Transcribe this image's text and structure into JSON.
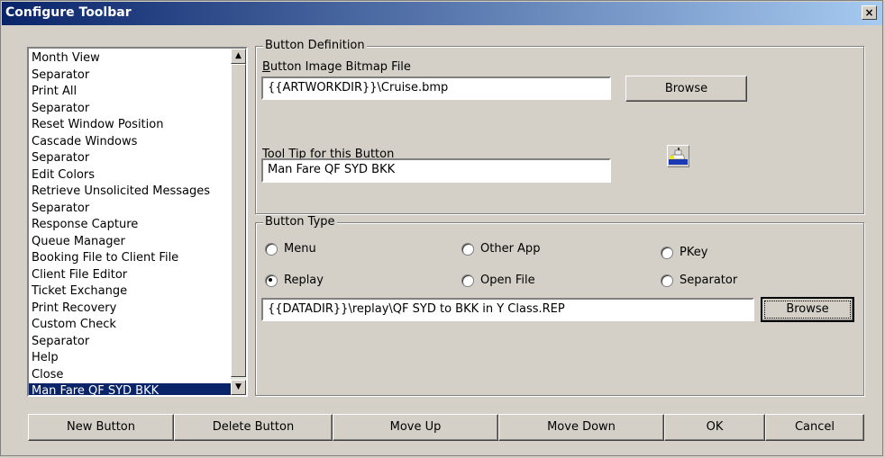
{
  "window": {
    "title": "Configure Toolbar",
    "close_glyph": "×"
  },
  "list": {
    "items": [
      "Month View",
      "Separator",
      "Print All",
      "Separator",
      "Reset Window Position",
      "Cascade Windows",
      "Separator",
      "Edit Colors",
      "Retrieve Unsolicited Messages",
      "Separator",
      "Response Capture",
      "Queue Manager",
      "Booking File to Client File",
      "Client File Editor",
      "Ticket Exchange",
      "Print Recovery",
      "Custom Check",
      "Separator",
      "Help",
      "Close",
      "Man Fare QF SYD BKK"
    ],
    "selected_index": 20,
    "scroll_up_glyph": "▲",
    "scroll_down_glyph": "▼"
  },
  "button_definition": {
    "legend": "Button Definition",
    "bitmap_label": "Button Image Bitmap File",
    "bitmap_value": "{{ARTWORKDIR}}\\Cruise.bmp",
    "browse_label": "Browse",
    "tooltip_label": "Tool Tip for this Button",
    "tooltip_value": "Man Fare QF SYD BKK",
    "preview_icon": "cruise-ship-icon"
  },
  "button_type": {
    "legend": "Button Type",
    "options": [
      {
        "label": "Menu",
        "checked": false
      },
      {
        "label": "Other App",
        "checked": false
      },
      {
        "label": "PKey",
        "checked": false
      },
      {
        "label": "Replay",
        "checked": true
      },
      {
        "label": "Open File",
        "checked": false
      },
      {
        "label": "Separator",
        "checked": false
      }
    ],
    "file_value": "{{DATADIR}}\\replay\\QF SYD to BKK in Y Class.REP",
    "browse_label": "Browse"
  },
  "footer": {
    "new_button": "New Button",
    "delete_button": "Delete Button",
    "move_up": "Move Up",
    "move_down": "Move Down",
    "ok": "OK",
    "cancel": "Cancel"
  }
}
